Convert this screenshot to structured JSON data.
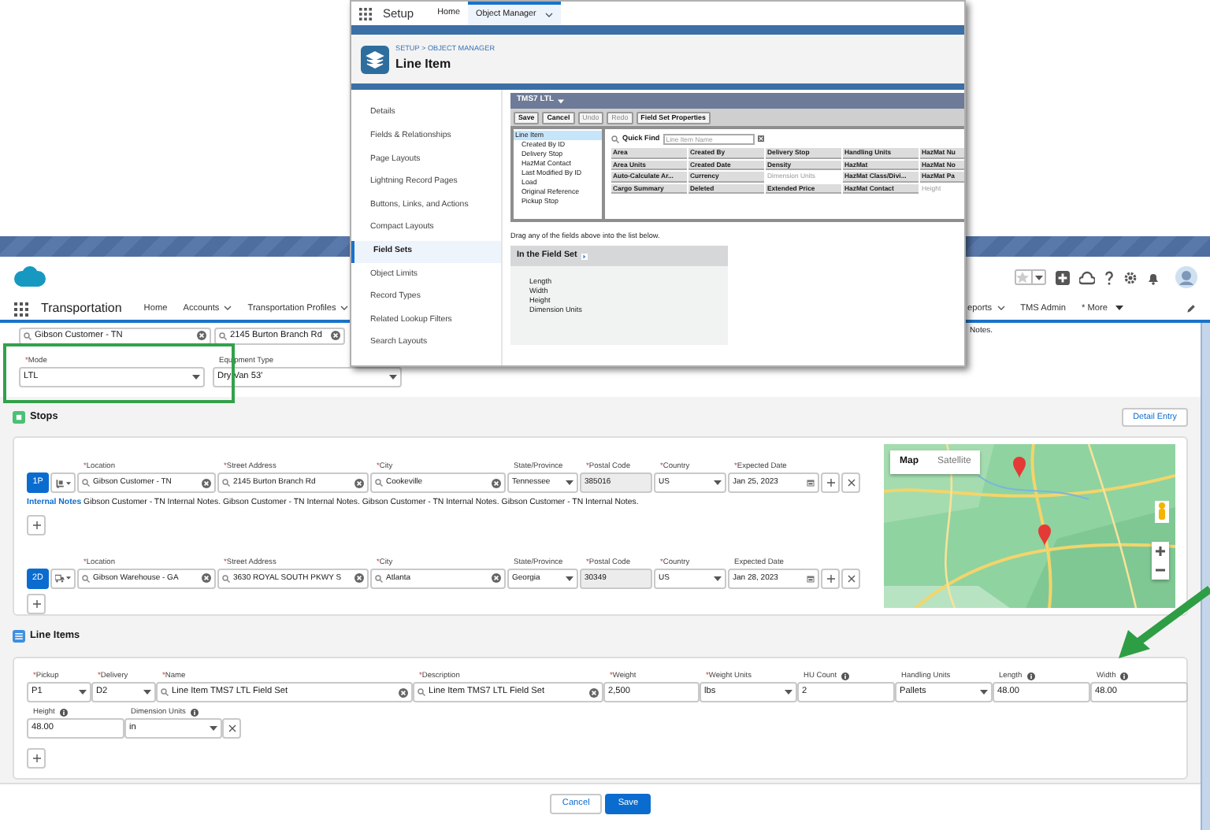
{
  "setup_window": {
    "app_name": "Setup",
    "tabs": [
      {
        "label": "Home",
        "selected": false
      },
      {
        "label": "Object Manager",
        "selected": true
      }
    ],
    "breadcrumb": "SETUP > OBJECT MANAGER",
    "title": "Line Item",
    "sidebar": [
      {
        "label": "Details",
        "selected": false
      },
      {
        "label": "Fields & Relationships",
        "selected": false
      },
      {
        "label": "Page Layouts",
        "selected": false
      },
      {
        "label": "Lightning Record Pages",
        "selected": false
      },
      {
        "label": "Buttons, Links, and Actions",
        "selected": false
      },
      {
        "label": "Compact Layouts",
        "selected": false
      },
      {
        "label": "Field Sets",
        "selected": true
      },
      {
        "label": "Object Limits",
        "selected": false
      },
      {
        "label": "Record Types",
        "selected": false
      },
      {
        "label": "Related Lookup Filters",
        "selected": false
      },
      {
        "label": "Search Layouts",
        "selected": false
      }
    ],
    "editor": {
      "name": "TMS7 LTL",
      "toolbar": [
        {
          "label": "Save",
          "disabled": false
        },
        {
          "label": "Cancel",
          "disabled": false
        },
        {
          "label": "Undo",
          "disabled": true
        },
        {
          "label": "Redo",
          "disabled": true
        },
        {
          "label": "Field Set Properties",
          "disabled": false
        }
      ],
      "objects": [
        {
          "label": "Line Item",
          "selected": true
        },
        {
          "label": "Created By ID",
          "selected": false
        },
        {
          "label": "Delivery Stop",
          "selected": false
        },
        {
          "label": "HazMat Contact",
          "selected": false
        },
        {
          "label": "Last Modified By ID",
          "selected": false
        },
        {
          "label": "Load",
          "selected": false
        },
        {
          "label": "Original Reference",
          "selected": false
        },
        {
          "label": "Pickup Stop",
          "selected": false
        }
      ],
      "quick_find": {
        "label": "Quick Find",
        "placeholder": "Line Item Name"
      },
      "field_rows": [
        [
          {
            "label": "Area",
            "in_set": false
          },
          {
            "label": "Created By",
            "in_set": false
          },
          {
            "label": "Delivery Stop",
            "in_set": false
          },
          {
            "label": "Handling Units",
            "in_set": false
          },
          {
            "label": "HazMat Nu",
            "in_set": false
          }
        ],
        [
          {
            "label": "Area Units",
            "in_set": false
          },
          {
            "label": "Created Date",
            "in_set": false
          },
          {
            "label": "Density",
            "in_set": false
          },
          {
            "label": "HazMat",
            "in_set": false
          },
          {
            "label": "HazMat No",
            "in_set": false
          }
        ],
        [
          {
            "label": "Auto-Calculate Ar...",
            "in_set": false
          },
          {
            "label": "Currency",
            "in_set": false
          },
          {
            "label": "Dimension Units",
            "in_set": true
          },
          {
            "label": "HazMat Class/Divi...",
            "in_set": false
          },
          {
            "label": "HazMat Pa",
            "in_set": false
          }
        ],
        [
          {
            "label": "Cargo Summary",
            "in_set": false
          },
          {
            "label": "Deleted",
            "in_set": false
          },
          {
            "label": "Extended Price",
            "in_set": false
          },
          {
            "label": "HazMat Contact",
            "in_set": false
          },
          {
            "label": "Height",
            "in_set": true
          }
        ]
      ],
      "hint": "Drag any of the fields above into the list below.",
      "in_set_title": "In the Field Set",
      "in_set_fields": [
        "Length",
        "Width",
        "Height",
        "Dimension Units"
      ]
    }
  },
  "app": {
    "name": "Transportation",
    "nav": [
      {
        "label": "Home",
        "kind": "plain"
      },
      {
        "label": "Accounts",
        "kind": "menu"
      },
      {
        "label": "Transportation Profiles",
        "kind": "menu"
      }
    ],
    "nav_right": [
      {
        "label": "eports",
        "kind": "menu"
      },
      {
        "label": "TMS Admin",
        "kind": "plain"
      },
      {
        "label": "* More",
        "kind": "overflow"
      }
    ]
  },
  "search_fields": [
    {
      "value": "Gibson Customer - TN"
    },
    {
      "value": "2145 Burton Branch Rd"
    }
  ],
  "notes_fragment": "Notes.",
  "load_fields": [
    {
      "label": "Mode",
      "mark": "*",
      "kind": "select",
      "value": "LTL"
    },
    {
      "label": "Equipment Type",
      "kind": "select",
      "value": "Dry Van 53'"
    }
  ],
  "stops": {
    "title": "Stops",
    "detail_button": "Detail Entry",
    "rows": [
      {
        "badge": "1P",
        "kind": "pickup",
        "fields": [
          {
            "label": "Location",
            "mark": "*",
            "kind": "lookup",
            "value": "Gibson Customer - TN"
          },
          {
            "label": "Street Address",
            "mark": "*",
            "kind": "lookup",
            "value": "2145 Burton Branch Rd"
          },
          {
            "label": "City",
            "mark": "*",
            "kind": "lookup",
            "value": "Cookeville"
          },
          {
            "label": "State/Province",
            "kind": "select",
            "value": "Tennessee"
          },
          {
            "label": "Postal Code",
            "mark": "*",
            "kind": "readonly",
            "value": "385016"
          },
          {
            "label": "Country",
            "mark": "*",
            "kind": "select",
            "value": "US"
          },
          {
            "label": "Expected Date",
            "mark": "*",
            "kind": "date",
            "value": "Jan 25, 2023"
          }
        ],
        "notes_label": "Internal Notes",
        "notes": "Gibson Customer - TN Internal Notes. Gibson Customer - TN Internal Notes. Gibson Customer - TN Internal Notes. Gibson Customer - TN Internal Notes."
      },
      {
        "badge": "2D",
        "kind": "delivery",
        "fields": [
          {
            "label": "Location",
            "mark": "*",
            "kind": "lookup",
            "value": "Gibson Warehouse - GA"
          },
          {
            "label": "Street Address",
            "mark": "*",
            "kind": "lookup",
            "value": "3630 ROYAL SOUTH PKWY S"
          },
          {
            "label": "City",
            "mark": "*",
            "kind": "lookup",
            "value": "Atlanta"
          },
          {
            "label": "State/Province",
            "kind": "select",
            "value": "Georgia"
          },
          {
            "label": "Postal Code",
            "mark": "*",
            "kind": "readonly",
            "value": "30349"
          },
          {
            "label": "Country",
            "mark": "*",
            "kind": "select",
            "value": "US"
          },
          {
            "label": "Expected Date",
            "kind": "date",
            "value": "Jan 28, 2023"
          }
        ]
      }
    ],
    "map": {
      "tabs": [
        {
          "label": "Map",
          "selected": true
        },
        {
          "label": "Satellite",
          "selected": false
        }
      ]
    }
  },
  "line_items": {
    "title": "Line Items",
    "rows": [
      [
        {
          "label": "Pickup",
          "mark": "*",
          "info": false,
          "kind": "select",
          "value": "P1"
        },
        {
          "label": "Delivery",
          "mark": "*",
          "info": false,
          "kind": "select",
          "value": "D2"
        },
        {
          "label": "Name",
          "mark": "*",
          "info": false,
          "kind": "lookup",
          "value": "Line Item TMS7 LTL Field Set"
        },
        {
          "label": "Description",
          "mark": "*",
          "info": false,
          "kind": "lookup",
          "value": "Line Item TMS7 LTL Field Set"
        },
        {
          "label": "Weight",
          "mark": "*",
          "info": false,
          "kind": "text",
          "value": "2,500"
        },
        {
          "label": "Weight Units",
          "mark": "*",
          "info": false,
          "kind": "select",
          "value": "lbs"
        },
        {
          "label": "HU Count",
          "info": true,
          "kind": "text",
          "value": "2"
        },
        {
          "label": "Handling Units",
          "info": false,
          "kind": "select",
          "value": "Pallets"
        },
        {
          "label": "Length",
          "info": true,
          "kind": "text",
          "value": "48.00"
        },
        {
          "label": "Width",
          "info": true,
          "kind": "text",
          "value": "48.00"
        }
      ],
      [
        {
          "label": "Height",
          "info": true,
          "kind": "text",
          "value": "48.00"
        },
        {
          "label": "Dimension Units",
          "info": true,
          "kind": "select",
          "value": "in"
        }
      ]
    ]
  },
  "footer": [
    {
      "label": "Cancel",
      "kind": "neutral"
    },
    {
      "label": "Save",
      "kind": "brand"
    }
  ]
}
